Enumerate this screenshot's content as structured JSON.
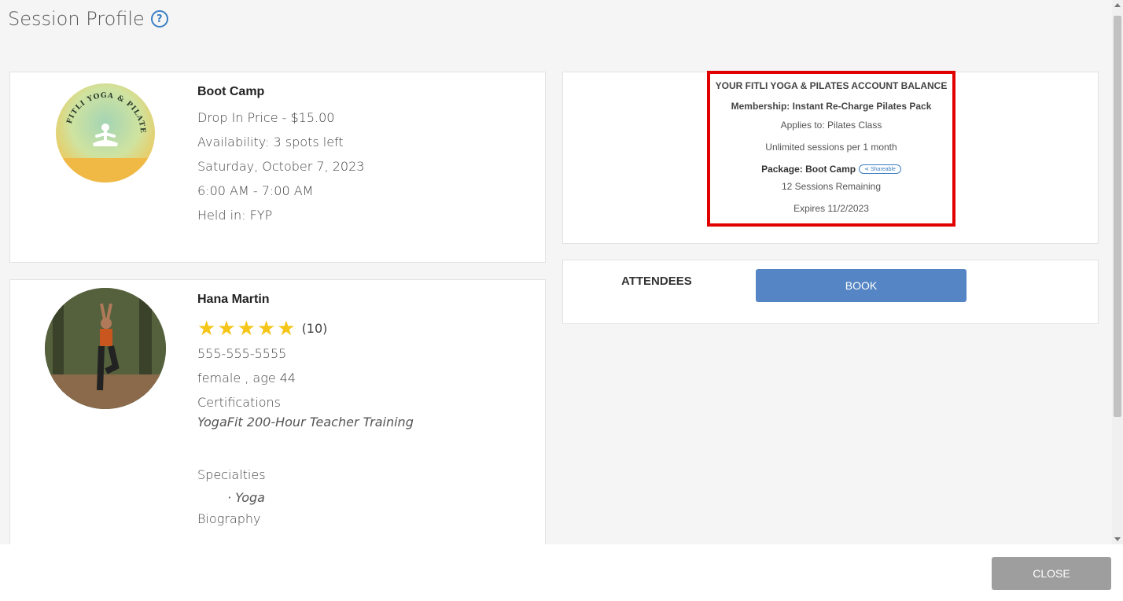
{
  "page": {
    "title": "Session Profile",
    "help_icon": "?"
  },
  "session": {
    "name": "Boot Camp",
    "drop_in_price": "Drop In Price - $15.00",
    "availability": "Availability: 3 spots left",
    "date": "Saturday, October 7, 2023",
    "time": "6:00 AM - 7:00 AM",
    "held_in": "Held in: FYP",
    "logo_text": "FITLI YOGA & PILATES"
  },
  "instructor": {
    "name": "Hana Martin",
    "rating_stars": 5,
    "rating_count": "(10)",
    "phone": "555-555-5555",
    "demographics": "female , age 44",
    "certifications_label": "Certifications",
    "certification": "YogaFit 200-Hour Teacher Training",
    "specialties_label": "Specialties",
    "specialty": "· Yoga",
    "biography_label": "Biography"
  },
  "balance": {
    "title": "YOUR FITLI YOGA & PILATES ACCOUNT BALANCE",
    "membership": "Membership: Instant Re-Charge Pilates Pack",
    "applies_to": "Applies to: Pilates Class",
    "unlimited": "Unlimited sessions per 1 month",
    "package": "Package: Boot Camp",
    "shareable": "Shareable",
    "sessions_remaining": "12 Sessions Remaining",
    "expires": "Expires 11/2/2023",
    "highlight_color": "#e00000"
  },
  "attendees": {
    "label": "ATTENDEES",
    "book_label": "BOOK",
    "book_color": "#5585c4"
  },
  "footer": {
    "close_label": "CLOSE"
  }
}
